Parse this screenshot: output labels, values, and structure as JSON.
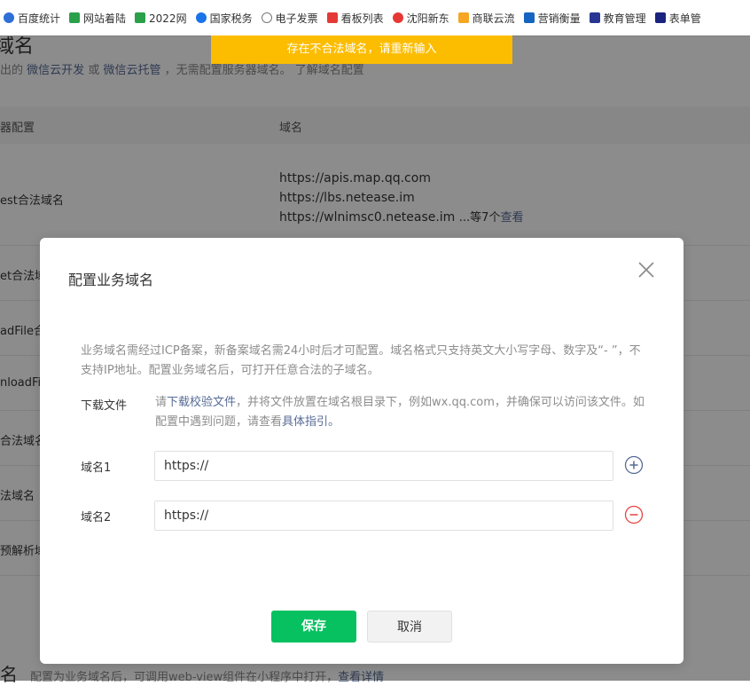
{
  "bookmarks": [
    {
      "label": "百度统计",
      "color": "#2f6fd6"
    },
    {
      "label": "网站着陆",
      "color": "#2aa04b"
    },
    {
      "label": "2022网",
      "color": "#2aa04b"
    },
    {
      "label": "国家税务",
      "color": "#1a73e8"
    },
    {
      "label": "电子发票",
      "color": "#777777"
    },
    {
      "label": "看板列表",
      "color": "#e53935"
    },
    {
      "label": "沈阳新东",
      "color": "#e53935"
    },
    {
      "label": "商联云流",
      "color": "#f5a623"
    },
    {
      "label": "营销衡量",
      "color": "#1565c0"
    },
    {
      "label": "教育管理",
      "color": "#283593"
    },
    {
      "label": "表单管",
      "color": "#1a237e"
    }
  ],
  "toast": {
    "text": "存在不合法域名，请重新输入"
  },
  "page": {
    "title": "域名",
    "desc_prefix": "出的",
    "desc_link1": "微信云开发",
    "desc_or": "或",
    "desc_link2": "微信云托管",
    "desc_mid": "，无需配置服务器域名。",
    "desc_link3": "了解域名配置",
    "col_config": "器配置",
    "col_domain": "域名",
    "rows": [
      {
        "label": "est合法域名",
        "domains": [
          "https://apis.map.qq.com",
          "https://lbs.netease.im",
          "https://wlnimsc0.netease.im"
        ],
        "more": "...等7个",
        "view": "查看"
      },
      {
        "label": "et合法域"
      },
      {
        "label": "adFile合"
      },
      {
        "label": "nloadFi"
      },
      {
        "label": "合法域名"
      },
      {
        "label": "法域名"
      },
      {
        "label": "预解析域"
      }
    ],
    "bottom_title": "名",
    "bottom_desc": "配置为业务域名后，可调用web-view组件在小程序中打开，",
    "bottom_link": "查看详情"
  },
  "dialog": {
    "title": "配置业务域名",
    "notice": "业务域名需经过ICP备案，新备案域名需24小时后才可配置。域名格式只支持英文大小写字母、数字及“- ”，不支持IP地址。配置业务域名后，可打开任意合法的子域名。",
    "download_label": "下载文件",
    "download_pre": "请",
    "download_link": "下载校验文件",
    "download_mid": "，并将文件放置在域名根目录下，例如wx.qq.com，并确保可以访问该文件。如配置中遇到问题，请查看",
    "download_link2": "具体指引",
    "download_end": "。",
    "fields": [
      {
        "label": "域名1",
        "value": "https://",
        "action": "plus-circle-icon"
      },
      {
        "label": "域名2",
        "value": "https://",
        "action": "minus-circle-icon"
      }
    ],
    "save_label": "保存",
    "cancel_label": "取消"
  },
  "colors": {
    "primary": "#07c160",
    "toast": "#fcbd00",
    "link": "#576b95",
    "danger": "#e64340",
    "add": "#576b95"
  }
}
